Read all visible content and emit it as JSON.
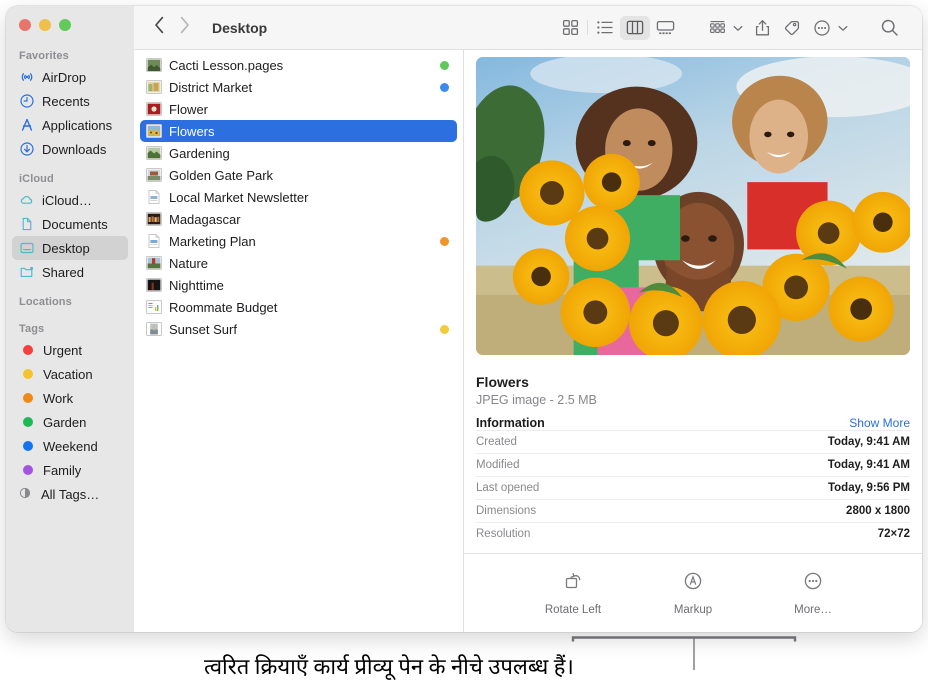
{
  "window": {
    "title": "Desktop",
    "traffic_lights": [
      {
        "name": "close",
        "color": "#e8756c"
      },
      {
        "name": "minimize",
        "color": "#eec04a"
      },
      {
        "name": "maximize",
        "color": "#63c95a"
      }
    ]
  },
  "toolbar": {
    "back_label": "Back",
    "forward_label": "Forward",
    "breadcrumb": "Desktop",
    "buttons": [
      {
        "name": "icon-view",
        "label": "Icon View",
        "active": false
      },
      {
        "name": "list-view",
        "label": "List View",
        "active": false
      },
      {
        "name": "column-view",
        "label": "Column View",
        "active": true
      },
      {
        "name": "gallery-view",
        "label": "Gallery View",
        "active": false
      },
      {
        "name": "group-by",
        "label": "Group",
        "active": false
      },
      {
        "name": "share",
        "label": "Share",
        "active": false
      },
      {
        "name": "tag",
        "label": "Tags",
        "active": false
      },
      {
        "name": "more-actions",
        "label": "More",
        "active": false
      },
      {
        "name": "search",
        "label": "Search",
        "active": false
      }
    ]
  },
  "sidebar": {
    "groups": [
      {
        "header": "Favorites",
        "items": [
          {
            "label": "AirDrop",
            "icon": "airdrop-icon",
            "selected": false
          },
          {
            "label": "Recents",
            "icon": "clock-icon",
            "selected": false
          },
          {
            "label": "Applications",
            "icon": "applications-icon",
            "selected": false
          },
          {
            "label": "Downloads",
            "icon": "downloads-icon",
            "selected": false
          }
        ]
      },
      {
        "header": "iCloud",
        "items": [
          {
            "label": "iCloud…",
            "icon": "cloud-icon",
            "selected": false
          },
          {
            "label": "Documents",
            "icon": "document-icon",
            "selected": false
          },
          {
            "label": "Desktop",
            "icon": "desktop-icon",
            "selected": true
          },
          {
            "label": "Shared",
            "icon": "shared-icon",
            "selected": false
          }
        ]
      },
      {
        "header": "Locations",
        "items": []
      },
      {
        "header": "Tags",
        "items": [
          {
            "label": "Urgent",
            "icon": "tag-dot",
            "color": "#f5413d",
            "selected": false
          },
          {
            "label": "Vacation",
            "icon": "tag-dot",
            "color": "#f6c32c",
            "selected": false
          },
          {
            "label": "Work",
            "icon": "tag-dot",
            "color": "#ef8a17",
            "selected": false
          },
          {
            "label": "Garden",
            "icon": "tag-dot",
            "color": "#1db954",
            "selected": false
          },
          {
            "label": "Weekend",
            "icon": "tag-dot",
            "color": "#1573f0",
            "selected": false
          },
          {
            "label": "Family",
            "icon": "tag-dot",
            "color": "#a353e0",
            "selected": false
          },
          {
            "label": "All Tags…",
            "icon": "all-tags-icon",
            "color": "",
            "selected": false
          }
        ]
      }
    ]
  },
  "file_list": [
    {
      "name": "Cacti Lesson.pages",
      "kind": "image",
      "tag_color": "#5ec95a",
      "selected": false
    },
    {
      "name": "District Market",
      "kind": "image",
      "tag_color": "#3b8aee",
      "selected": false
    },
    {
      "name": "Flower",
      "kind": "image",
      "tag_color": "",
      "selected": false
    },
    {
      "name": "Flowers",
      "kind": "image",
      "tag_color": "",
      "selected": true
    },
    {
      "name": "Gardening",
      "kind": "image",
      "tag_color": "",
      "selected": false
    },
    {
      "name": "Golden Gate Park",
      "kind": "image",
      "tag_color": "",
      "selected": false
    },
    {
      "name": "Local Market Newsletter",
      "kind": "document",
      "tag_color": "",
      "selected": false
    },
    {
      "name": "Madagascar",
      "kind": "image",
      "tag_color": "",
      "selected": false
    },
    {
      "name": "Marketing Plan",
      "kind": "document",
      "tag_color": "#f0952a",
      "selected": false
    },
    {
      "name": "Nature",
      "kind": "image",
      "tag_color": "",
      "selected": false
    },
    {
      "name": "Nighttime",
      "kind": "image",
      "tag_color": "",
      "selected": false
    },
    {
      "name": "Roommate Budget",
      "kind": "document",
      "tag_color": "",
      "selected": false
    },
    {
      "name": "Sunset Surf",
      "kind": "image",
      "tag_color": "#f2cb3a",
      "selected": false
    }
  ],
  "preview": {
    "image_alt": "Three people holding large bouquets of sunflowers in a sunny field",
    "file_name": "Flowers",
    "file_meta": "JPEG image - 2.5 MB",
    "information_title": "Information",
    "show_more": "Show More",
    "rows": [
      {
        "key": "Created",
        "value": "Today, 9:41 AM"
      },
      {
        "key": "Modified",
        "value": "Today, 9:41 AM"
      },
      {
        "key": "Last opened",
        "value": "Today, 9:56 PM"
      },
      {
        "key": "Dimensions",
        "value": "2800 x 1800"
      },
      {
        "key": "Resolution",
        "value": "72×72"
      }
    ],
    "quick_actions": [
      {
        "label": "Rotate Left",
        "icon": "rotate-left-icon"
      },
      {
        "label": "Markup",
        "icon": "markup-icon"
      },
      {
        "label": "More…",
        "icon": "more-circle-icon"
      }
    ]
  },
  "caption": {
    "text": "त्वरित क्रियाएँ कार्य प्रीव्यू पेन के नीचे उपलब्ध हैं।"
  },
  "colors": {
    "accent": "#2b6fe0",
    "sidebar_bg": "#e7e7e7",
    "toolbar_bg": "#f6f6f6",
    "icloud_icon": "#4fb9c8",
    "favorite_icon": "#2b6fe0"
  }
}
